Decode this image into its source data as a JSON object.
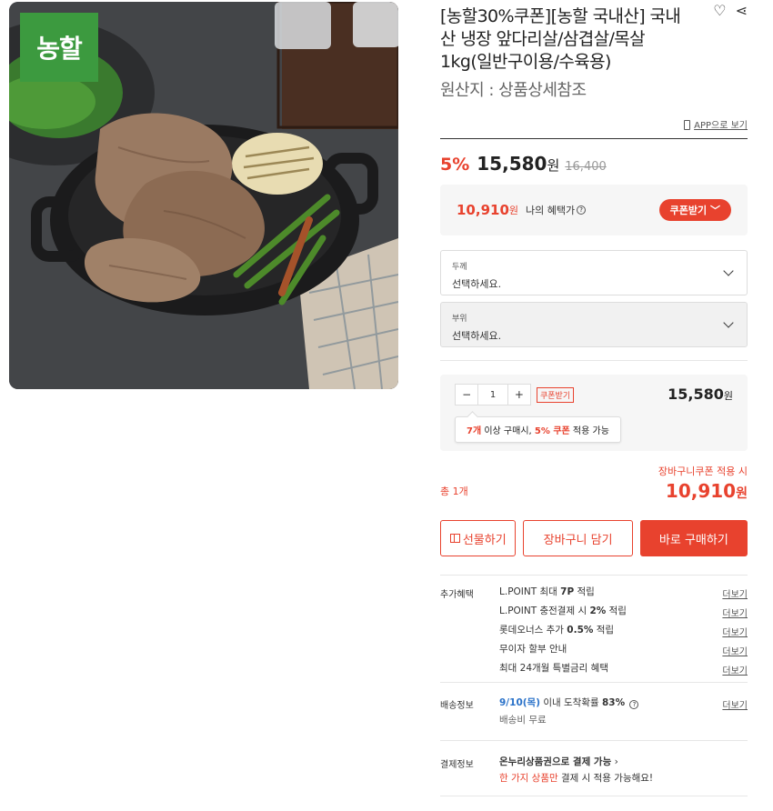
{
  "product": {
    "title": "[농할30%쿠폰][농할 국내산] 국내산 냉장 앞다리살/삼겹살/목살 1kg(일반구이용/수육용)",
    "origin": "원산지 : 상품상세참조",
    "logo_text": "농할",
    "image_icon": "grilled-pork-photo"
  },
  "icons": {
    "like": "heart-icon",
    "share": "share-icon"
  },
  "app_link": "APP으로 보기",
  "price": {
    "discount": "5%",
    "current": "15,580",
    "won": "원",
    "original": "16,400"
  },
  "benefit": {
    "price": "10,910",
    "won": "원",
    "label": "나의 혜택가",
    "coupon_button": "쿠폰받기"
  },
  "options": [
    {
      "label": "두께",
      "value": "선택하세요."
    },
    {
      "label": "부위",
      "value": "선택하세요."
    }
  ],
  "quantity": {
    "minus": "−",
    "value": "1",
    "plus": "+",
    "coupon_tag": "쿠폰받기",
    "price": "15,580",
    "won": "원",
    "tooltip_count": "7개",
    "tooltip_mid": " 이상 구매시, ",
    "tooltip_coupon": "5% 쿠폰",
    "tooltip_end": " 적용 가능"
  },
  "total": {
    "note": "장바구니쿠폰 적용 시",
    "count": "총 1개",
    "price": "10,910",
    "won": "원"
  },
  "buttons": {
    "gift": "선물하기",
    "cart": "장바구니 담기",
    "buy": "바로 구매하기"
  },
  "extra_benefits": {
    "head": "추가혜택",
    "more": "더보기",
    "items": [
      {
        "pre": "L.POINT 최대 ",
        "bold": "7P",
        "post": " 적립"
      },
      {
        "pre": "L.POINT 충전결제 시 ",
        "bold": "2%",
        "post": " 적립"
      },
      {
        "pre": "롯데오너스 추가 ",
        "bold": "0.5%",
        "post": " 적립"
      },
      {
        "pre": "무이자 할부 안내",
        "bold": "",
        "post": ""
      },
      {
        "pre": "최대 24개월 특별금리 혜택",
        "bold": "",
        "post": ""
      }
    ]
  },
  "delivery": {
    "head": "배송정보",
    "date": "9/10(목)",
    "text": " 이내 도착확률 ",
    "prob": "83%",
    "fee": "배송비 무료",
    "more": "더보기"
  },
  "payment": {
    "head": "결제정보",
    "line1": "온누리상품권으로 결제 가능",
    "line2_red": "한 가지 상품만",
    "line2_rest": " 결제 시 적용 가능해요!"
  },
  "colors": {
    "accent": "#e8422e",
    "brand_green": "#3c9a3f",
    "date_blue": "#2a72c9"
  }
}
